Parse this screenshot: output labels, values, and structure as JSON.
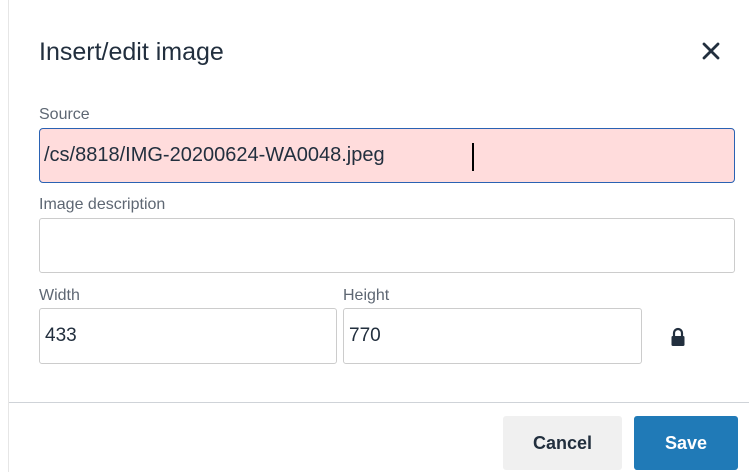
{
  "dialog": {
    "title": "Insert/edit image",
    "close_icon": "close-icon"
  },
  "fields": {
    "source_label": "Source",
    "source_value": "/cs/8818/IMG-20200624-WA0048.jpeg",
    "description_label": "Image description",
    "description_value": "",
    "width_label": "Width",
    "width_value": "433",
    "height_label": "Height",
    "height_value": "770",
    "lock_icon": "lock-icon"
  },
  "footer": {
    "cancel_label": "Cancel",
    "save_label": "Save"
  },
  "colors": {
    "source_invalid_bg": "#ffdcdc",
    "focus_border": "#2a62b3",
    "save_bg": "#207ab7",
    "cancel_bg": "#f0f0f0",
    "title_text": "#222f3e"
  }
}
